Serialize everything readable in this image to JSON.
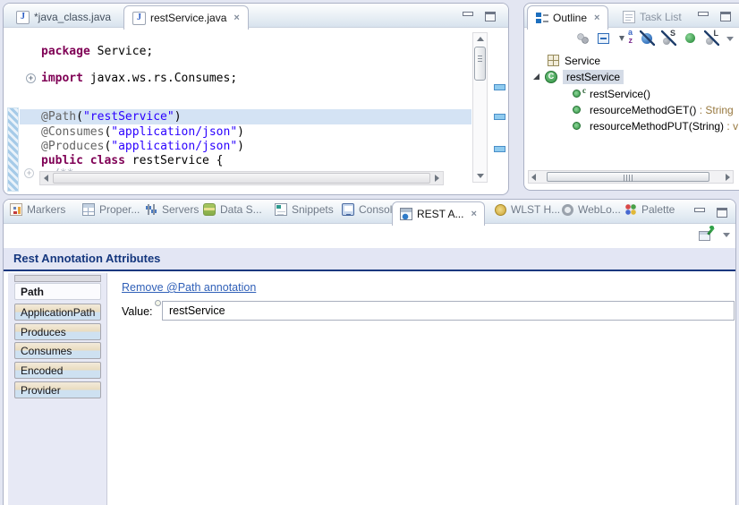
{
  "icons": {
    "close": "×",
    "plus": "+",
    "java_j": "J",
    "class_c": "C",
    "constructor_c": "c",
    "sort_a": "a",
    "sort_z": "z",
    "static_s": "S",
    "local_l": "L"
  },
  "editor": {
    "tabs": [
      {
        "label": "*java_class.java"
      },
      {
        "label": "restService.java"
      }
    ],
    "code_lines": [
      {
        "segs": [
          {
            "t": "package"
          },
          {
            "t": " Service;"
          }
        ]
      },
      {
        "segs": [
          {
            "t": "import"
          },
          {
            "t": " javax.ws.rs.Consumes;"
          }
        ]
      },
      {
        "segs": [
          {
            "t": "@Path"
          },
          {
            "t": "("
          },
          {
            "t": "\"restService\""
          },
          {
            "t": ")"
          }
        ]
      },
      {
        "segs": [
          {
            "t": "@Consumes"
          },
          {
            "t": "("
          },
          {
            "t": "\"application/json\""
          },
          {
            "t": ")"
          }
        ]
      },
      {
        "segs": [
          {
            "t": "@Produces"
          },
          {
            "t": "("
          },
          {
            "t": "\"application/json\""
          },
          {
            "t": ")"
          }
        ]
      },
      {
        "segs": [
          {
            "t": "public class"
          },
          {
            "t": " restService {"
          }
        ]
      }
    ],
    "folded_hint": "/**"
  },
  "outline": {
    "tab_label": "Outline",
    "task_list_label": "Task List",
    "tree": {
      "package": "Service",
      "class": "restService",
      "constructor": "restService()",
      "method_get": "resourceMethodGET()",
      "method_get_type": " : String",
      "method_put": "resourceMethodPUT(String)",
      "method_put_type": " : v"
    }
  },
  "bottom": {
    "tabs": [
      {
        "label": "Markers"
      },
      {
        "label": "Proper..."
      },
      {
        "label": "Servers"
      },
      {
        "label": "Data S..."
      },
      {
        "label": "Snippets"
      },
      {
        "label": "Console"
      },
      {
        "label": "REST A..."
      },
      {
        "label": "WLST H..."
      },
      {
        "label": "WebLo..."
      },
      {
        "label": "Palette"
      }
    ],
    "rest_panel": {
      "title": "Rest Annotation Attributes",
      "attributes": [
        "Path",
        "ApplicationPath",
        "Produces",
        "Consumes",
        "Encoded",
        "Provider"
      ],
      "link": "Remove @Path annotation",
      "value_label": "Value:",
      "value": "restService"
    }
  }
}
